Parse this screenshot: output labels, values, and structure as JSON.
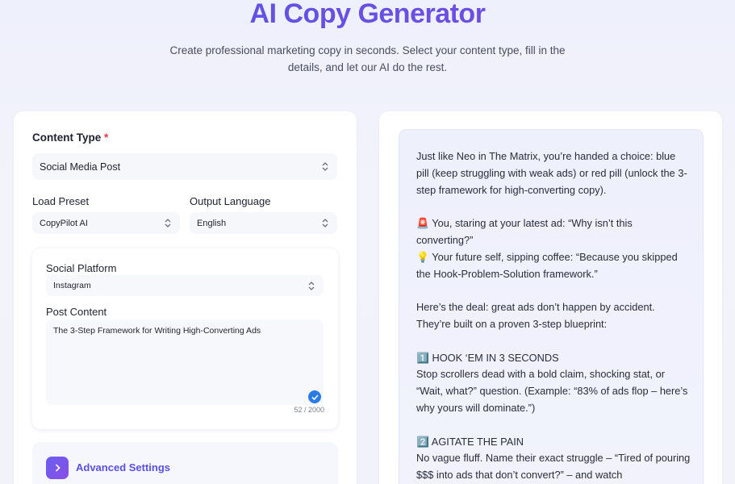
{
  "header": {
    "title": "AI Copy Generator",
    "subtitle": "Create professional marketing copy in seconds. Select your content type, fill in the details, and let our AI do the rest."
  },
  "form": {
    "content_type_label": "Content Type",
    "required_mark": "*",
    "content_type_value": "Social Media Post",
    "preset_label": "Load Preset",
    "preset_value": "CopyPilot AI",
    "language_label": "Output Language",
    "language_value": "English",
    "platform_label": "Social Platform",
    "platform_value": "Instagram",
    "post_content_label": "Post Content",
    "post_content_value": "The 3-Step Framework for Writing High-Converting Ads",
    "char_counter": "52 / 2000",
    "advanced_label": "Advanced Settings"
  },
  "output": {
    "lines": [
      "Just like Neo in The Matrix, you’re handed a choice: blue pill (keep struggling with weak ads) or red pill (unlock the 3-step framework for high-converting copy).",
      "",
      "🚨 You, staring at your latest ad: “Why isn’t this converting?”",
      "💡 Your future self, sipping coffee: “Because you skipped the Hook-Problem-Solution framework.”",
      "",
      "Here’s the deal: great ads don’t happen by accident. They’re built on a proven 3-step blueprint:",
      "",
      "1️⃣ HOOK ‘EM IN 3 SECONDS",
      "Stop scrollers dead with a bold claim, shocking stat, or “Wait, what?” question. (Example: “83% of ads flop – here’s why yours will dominate.”)",
      "",
      "2️⃣ AGITATE THE PAIN",
      "No vague fluff. Name their exact struggle – “Tired of pouring $$$ into ads that don’t convert?” – and watch"
    ]
  },
  "colors": {
    "accent": "#5b4fe0",
    "required": "#e0364a",
    "check": "#2b7be4"
  }
}
